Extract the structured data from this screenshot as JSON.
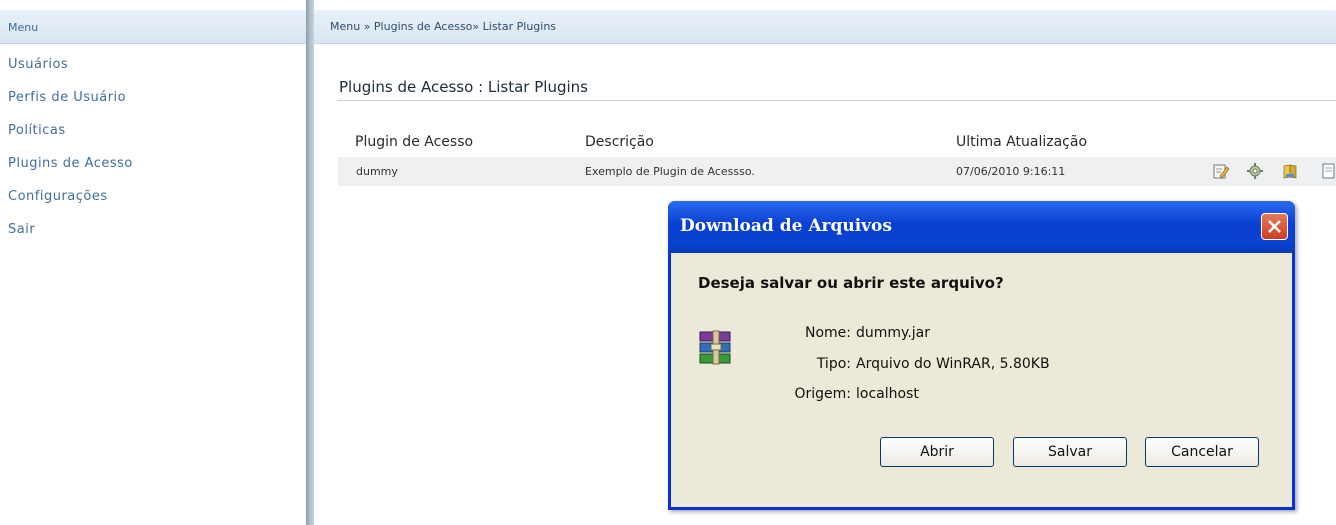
{
  "sidebar": {
    "title": "Menu",
    "items": [
      {
        "label": "Usuários"
      },
      {
        "label": "Perfis de Usuário"
      },
      {
        "label": "Políticas"
      },
      {
        "label": "Plugins de Acesso"
      },
      {
        "label": "Configurações"
      },
      {
        "label": "Sair"
      }
    ]
  },
  "breadcrumb": "Menu » Plugins de Acesso» Listar Plugins",
  "page_title": "Plugins de Acesso : Listar Plugins",
  "table": {
    "headers": [
      "Plugin de Acesso",
      "Descrição",
      "Ultima Atualização"
    ],
    "rows": [
      {
        "name": "dummy",
        "description": "Exemplo de Plugin de Acessso.",
        "updated": "07/06/2010 9:16:11",
        "actions": [
          "edit-icon",
          "gear-icon",
          "book-icon",
          "download-icon"
        ]
      }
    ]
  },
  "dialog": {
    "title": "Download de Arquivos",
    "question": "Deseja salvar ou abrir este arquivo?",
    "icon": "winrar-archive-icon",
    "fields": [
      {
        "label": "Nome:",
        "value": "dummy.jar"
      },
      {
        "label": "Tipo:",
        "value": "Arquivo do WinRAR, 5.80KB"
      },
      {
        "label": "Origem:",
        "value": "localhost"
      }
    ],
    "buttons": {
      "open": "Abrir",
      "save": "Salvar",
      "cancel": "Cancelar"
    }
  },
  "colors": {
    "title_bar": "#0a3fd1",
    "dialog_bg": "#ece9d8",
    "link": "#3f6f9d",
    "close": "#c9401f"
  }
}
